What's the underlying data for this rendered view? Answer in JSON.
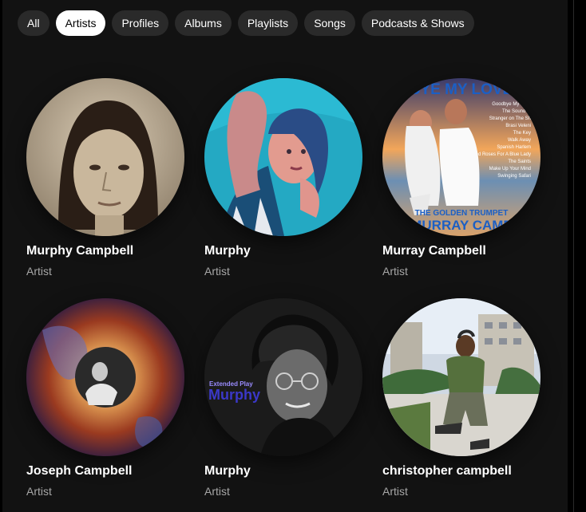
{
  "filters": [
    {
      "label": "All",
      "active": false
    },
    {
      "label": "Artists",
      "active": true
    },
    {
      "label": "Profiles",
      "active": false
    },
    {
      "label": "Albums",
      "active": false
    },
    {
      "label": "Playlists",
      "active": false
    },
    {
      "label": "Songs",
      "active": false
    },
    {
      "label": "Podcasts & Shows",
      "active": false
    }
  ],
  "results": [
    {
      "name": "Murphy Campbell",
      "type": "Artist"
    },
    {
      "name": "Murphy",
      "type": "Artist"
    },
    {
      "name": "Murray Campbell",
      "type": "Artist"
    },
    {
      "name": "Joseph Campbell",
      "type": "Artist"
    },
    {
      "name": "Murphy",
      "type": "Artist"
    },
    {
      "name": "christopher campbell",
      "type": "Artist"
    }
  ],
  "artwork": {
    "album_cover": {
      "title": "DBYE MY LOVE",
      "tracklist": [
        "Goodbye My Love",
        "The Sound of",
        "Stranger on The Sh",
        "Brasi Veleni",
        "The Key",
        "Walk Away",
        "Spanish Harlem",
        "Red Roses For A Blue Lady",
        "The Saints",
        "Make Up Your Mind",
        "Swinging Safari"
      ],
      "footer_line1": "THE GOLDEN TRUMPET",
      "footer_line2": "MURRAY CAMP"
    },
    "ep_cover": {
      "line1": "Extended Play",
      "line2": "Murphy"
    }
  },
  "colors": {
    "background": "#121212",
    "chip": "#2a2a2a",
    "chip_active": "#ffffff",
    "subtitle": "#a7a7a7"
  }
}
